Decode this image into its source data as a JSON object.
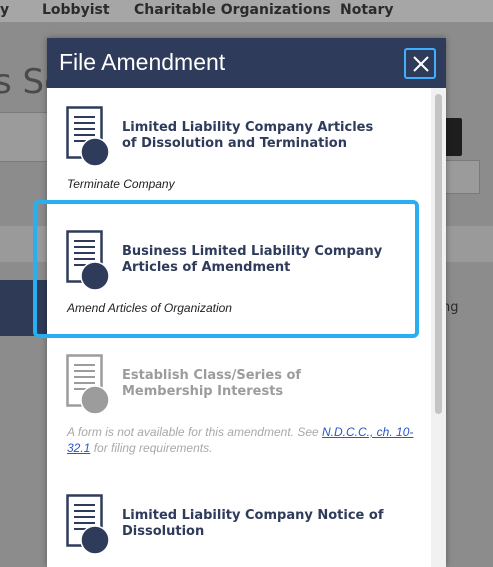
{
  "background": {
    "nav_items": [
      "y",
      "Lobbyist",
      "Charitable Organizations",
      "Notary"
    ],
    "title_fragment": "s Se",
    "right_fragment": "ng"
  },
  "modal": {
    "title": "File Amendment",
    "close_icon": "close-icon",
    "items": [
      {
        "title": "Limited Liability Company Articles of Dissolution and Termination",
        "description": "Terminate Company",
        "icon": "document-icon",
        "enabled": true
      },
      {
        "title": "Business Limited Liability Company Articles of Amendment",
        "description": "Amend Articles of Organization",
        "icon": "document-icon",
        "enabled": true,
        "selected": true
      },
      {
        "title": "Establish Class/Series of Membership Interests",
        "note_prefix": "A form is not available for this amendment.  See ",
        "note_link": "N.D.C.C., ch. 10-32.1",
        "note_suffix": " for filing requirements.",
        "icon": "document-icon",
        "enabled": false
      },
      {
        "title": "Limited Liability Company Notice of Dissolution",
        "icon": "document-icon",
        "enabled": true
      }
    ]
  },
  "colors": {
    "header": "#2f3b5a",
    "accent_focus": "#29aef0",
    "icon_dark": "#2f3b5a",
    "icon_disabled": "#9c9c9c"
  }
}
